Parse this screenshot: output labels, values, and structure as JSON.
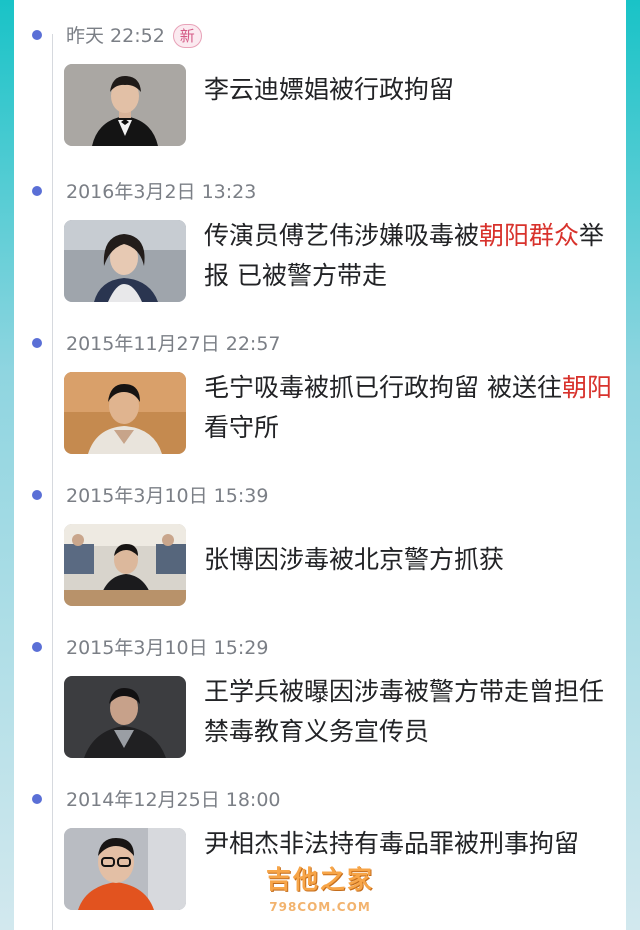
{
  "badge_new": "新",
  "entries": [
    {
      "time": "昨天 22:52",
      "has_badge": true,
      "thumb": "portrait-man-tuxedo",
      "title_parts": [
        {
          "text": "李云迪嫖娼被行政拘留",
          "hl": false
        }
      ]
    },
    {
      "time": "2016年3月2日 13:23",
      "has_badge": false,
      "thumb": "portrait-woman",
      "title_parts": [
        {
          "text": "传演员傅艺伟涉嫌吸毒被",
          "hl": false
        },
        {
          "text": "朝阳群众",
          "hl": true
        },
        {
          "text": "举报 已被警方带走",
          "hl": false
        }
      ]
    },
    {
      "time": "2015年11月27日 22:57",
      "has_badge": false,
      "thumb": "portrait-man-court",
      "title_parts": [
        {
          "text": "毛宁吸毒被抓已行政拘留 被送往",
          "hl": false
        },
        {
          "text": "朝阳",
          "hl": true
        },
        {
          "text": "看守所",
          "hl": false
        }
      ]
    },
    {
      "time": "2015年3月10日 15:39",
      "has_badge": false,
      "thumb": "court-scene",
      "title_parts": [
        {
          "text": "张博因涉毒被北京警方抓获",
          "hl": false
        }
      ]
    },
    {
      "time": "2015年3月10日 15:29",
      "has_badge": false,
      "thumb": "portrait-man-dark",
      "title_parts": [
        {
          "text": "王学兵被曝因涉毒被警方带走曾担任禁毒教育义务宣传员",
          "hl": false
        }
      ]
    },
    {
      "time": "2014年12月25日 18:00",
      "has_badge": false,
      "thumb": "portrait-man-glasses",
      "title_parts": [
        {
          "text": "尹相杰非法持有毒品罪被刑事拘留",
          "hl": false
        }
      ]
    }
  ],
  "watermark": {
    "text": "吉他之家",
    "sub": "798COM.COM"
  },
  "colors": {
    "timeline_dot": "#5a6fd6",
    "highlight": "#d8322c",
    "time_text": "#7b7f86",
    "headline_text": "#222326"
  }
}
